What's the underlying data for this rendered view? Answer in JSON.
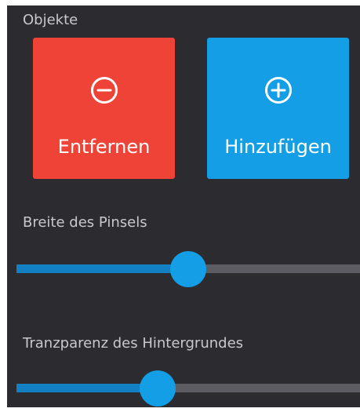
{
  "objects": {
    "label": "Objekte",
    "remove": {
      "label": "Entfernen",
      "icon": "minus-circle-icon",
      "color": "#ef4337"
    },
    "add": {
      "label": "Hinzufügen",
      "icon": "plus-circle-icon",
      "color": "#139ee6"
    }
  },
  "brush_width": {
    "label": "Breite des Pinsels",
    "value": 0.5
  },
  "background_transparency": {
    "label": "Tranzparenz des Hintergrundes",
    "value": 0.41
  },
  "colors": {
    "panel_background": "#2c2b30",
    "slider_fill": "#1380c4",
    "slider_track": "#5c5c62",
    "slider_thumb": "#139ee6"
  }
}
